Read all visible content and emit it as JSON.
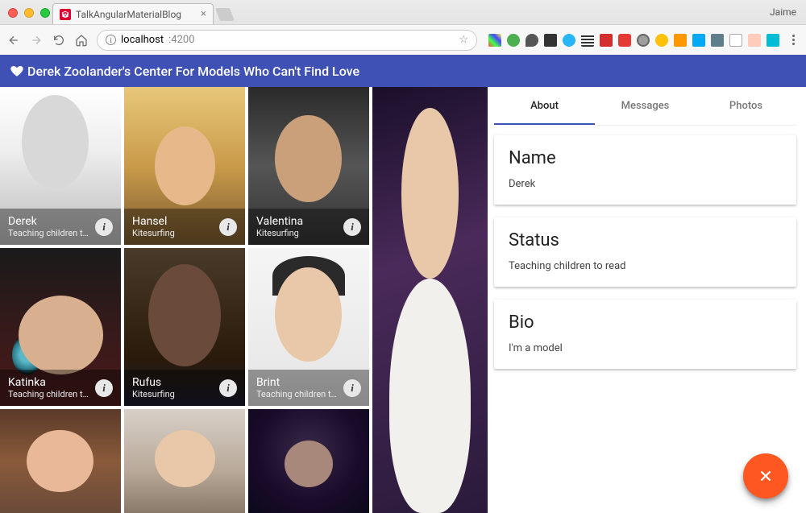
{
  "browser": {
    "tab_title": "TalkAngularMaterialBlog",
    "user": "Jaime",
    "url_host": "localhost",
    "url_port": ":4200"
  },
  "header": {
    "title": "Derek Zoolander's Center For Models Who Can't Find Love"
  },
  "models": [
    {
      "name": "Derek",
      "sub": "Teaching children to..."
    },
    {
      "name": "Hansel",
      "sub": "Kitesurfing"
    },
    {
      "name": "Valentina",
      "sub": "Kitesurfing"
    },
    {
      "name": "Katinka",
      "sub": "Teaching children to..."
    },
    {
      "name": "Rufus",
      "sub": "Kitesurfing"
    },
    {
      "name": "Brint",
      "sub": "Teaching children to..."
    }
  ],
  "detail_tabs": {
    "about": "About",
    "messages": "Messages",
    "photos": "Photos",
    "active": "about"
  },
  "detail": {
    "name_label": "Name",
    "name_value": "Derek",
    "status_label": "Status",
    "status_value": "Teaching children to read",
    "bio_label": "Bio",
    "bio_value": "I'm a model"
  }
}
